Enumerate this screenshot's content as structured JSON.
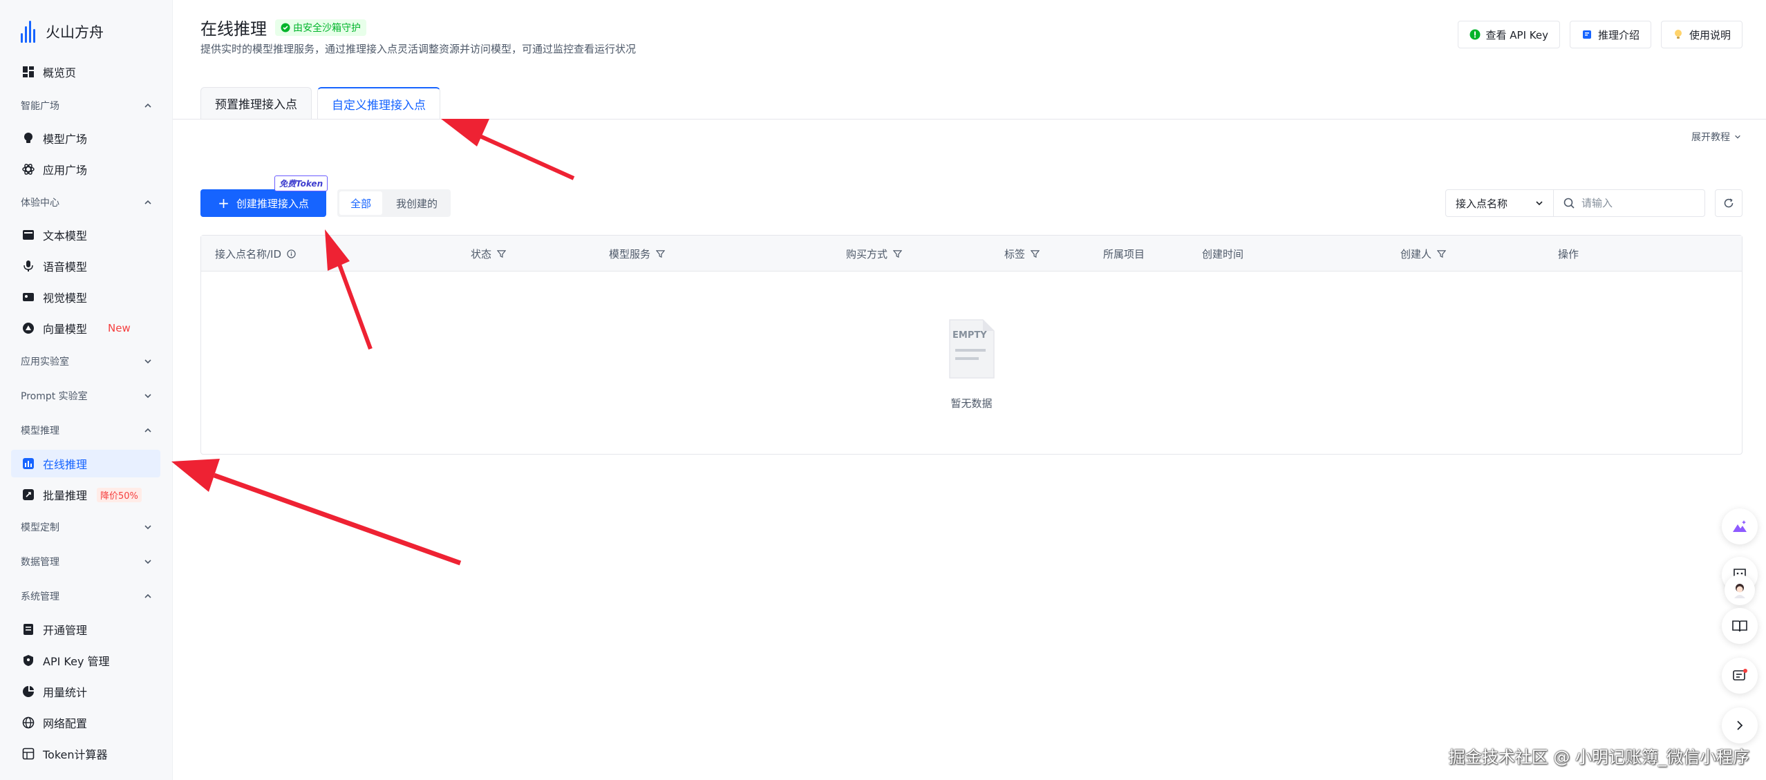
{
  "brand": {
    "name": "火山方舟"
  },
  "sidebar": {
    "overview": "概览页",
    "groups": [
      {
        "title": "智能广场",
        "items": [
          "模型广场",
          "应用广场"
        ]
      },
      {
        "title": "体验中心",
        "items": [
          "文本模型",
          "语音模型",
          "视觉模型",
          "向量模型"
        ]
      },
      {
        "title": "应用实验室"
      },
      {
        "title": "Prompt 实验室"
      },
      {
        "title": "模型推理",
        "items": [
          "在线推理",
          "批量推理"
        ]
      },
      {
        "title": "模型定制"
      },
      {
        "title": "数据管理"
      },
      {
        "title": "系统管理",
        "items": [
          "开通管理",
          "API Key 管理",
          "用量统计",
          "网络配置",
          "Token计算器"
        ]
      }
    ],
    "new_badge": "New",
    "discount_badge": "降价50%"
  },
  "header": {
    "title": "在线推理",
    "security_badge": "由安全沙箱守护",
    "description": "提供实时的模型推理服务，通过推理接入点灵活调整资源并访问模型，可通过监控查看运行状况",
    "buttons": [
      "查看 API Key",
      "推理介绍",
      "使用说明"
    ]
  },
  "tabs": [
    "预置推理接入点",
    "自定义推理接入点"
  ],
  "expand_tutorial": "展开教程",
  "toolbar": {
    "create_label": "创建推理接入点",
    "free_token": "免费Token",
    "segments": [
      "全部",
      "我创建的"
    ],
    "filter_select": "接入点名称",
    "search_placeholder": "请输入"
  },
  "table": {
    "columns": [
      "接入点名称/ID",
      "状态",
      "模型服务",
      "购买方式",
      "标签",
      "所属项目",
      "创建时间",
      "创建人",
      "操作"
    ],
    "empty_label": "EMPTY",
    "empty_text": "暂无数据"
  },
  "watermark": "掘金技术社区 @ 小明记账簿_微信小程序",
  "colors": {
    "primary": "#1664ff",
    "arrow": "#ee2233",
    "danger": "#f53f3f",
    "success": "#00b42a"
  }
}
